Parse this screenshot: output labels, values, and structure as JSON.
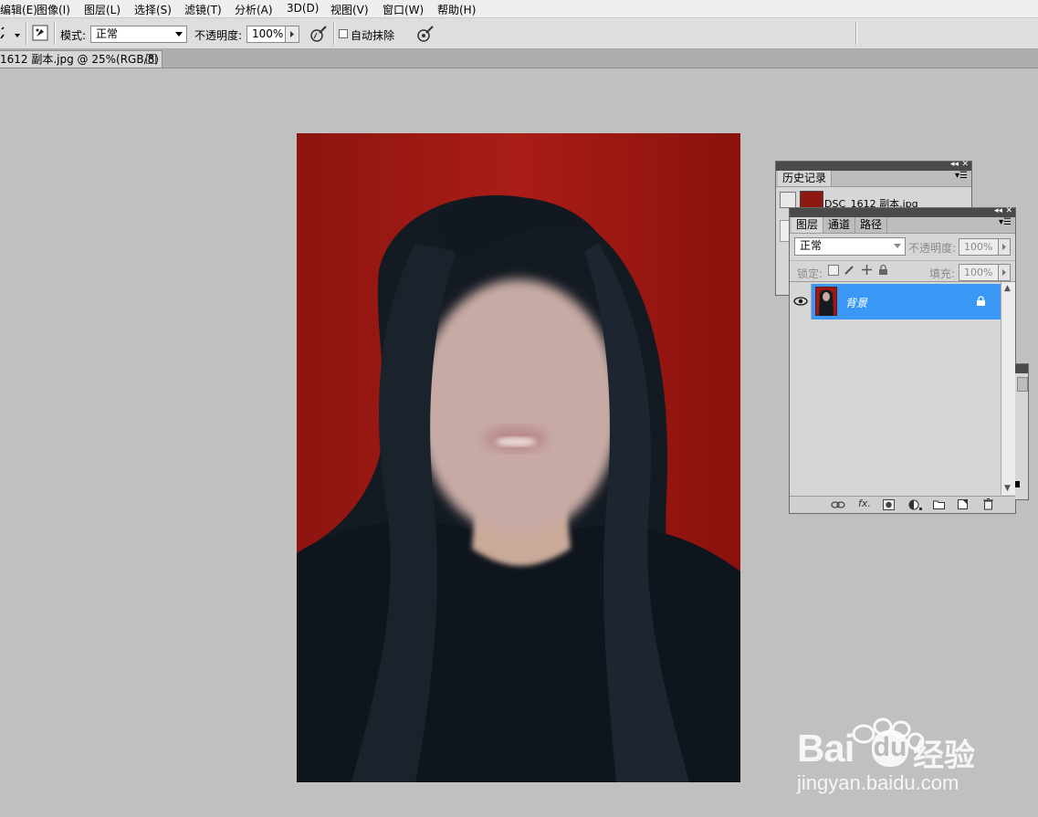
{
  "menu": {
    "items": [
      "编辑(E)",
      "图像(I)",
      "图层(L)",
      "选择(S)",
      "滤镜(T)",
      "分析(A)",
      "3D(D)",
      "视图(V)",
      "窗口(W)",
      "帮助(H)"
    ]
  },
  "options": {
    "mode_label": "模式:",
    "mode_value": "正常",
    "opacity_label": "不透明度:",
    "opacity_value": "100%",
    "auto_erase_label": "自动抹除",
    "auto_erase_checked": false
  },
  "document": {
    "tab_title": "1612 副本.jpg @ 25%(RGB/8)"
  },
  "history_panel": {
    "tab": "历史记录",
    "snapshot_name": "DSC_1612 副本.jpg"
  },
  "layers_panel": {
    "tabs": [
      "图层",
      "通道",
      "路径"
    ],
    "blend_mode": "正常",
    "opacity_label": "不透明度:",
    "opacity_value": "100%",
    "lock_label": "锁定:",
    "fill_label": "填充:",
    "fill_value": "100%",
    "layer_name": "背景",
    "fx_label": "fx."
  },
  "watermark": {
    "brand_a": "Bai",
    "brand_b": "du",
    "brand_c": "经验",
    "url": "jingyan.baidu.com"
  },
  "colors": {
    "accent_selected_layer": "#3b97f5",
    "photo_background": "#9e1711",
    "ui_gray": "#c0c0c0"
  }
}
